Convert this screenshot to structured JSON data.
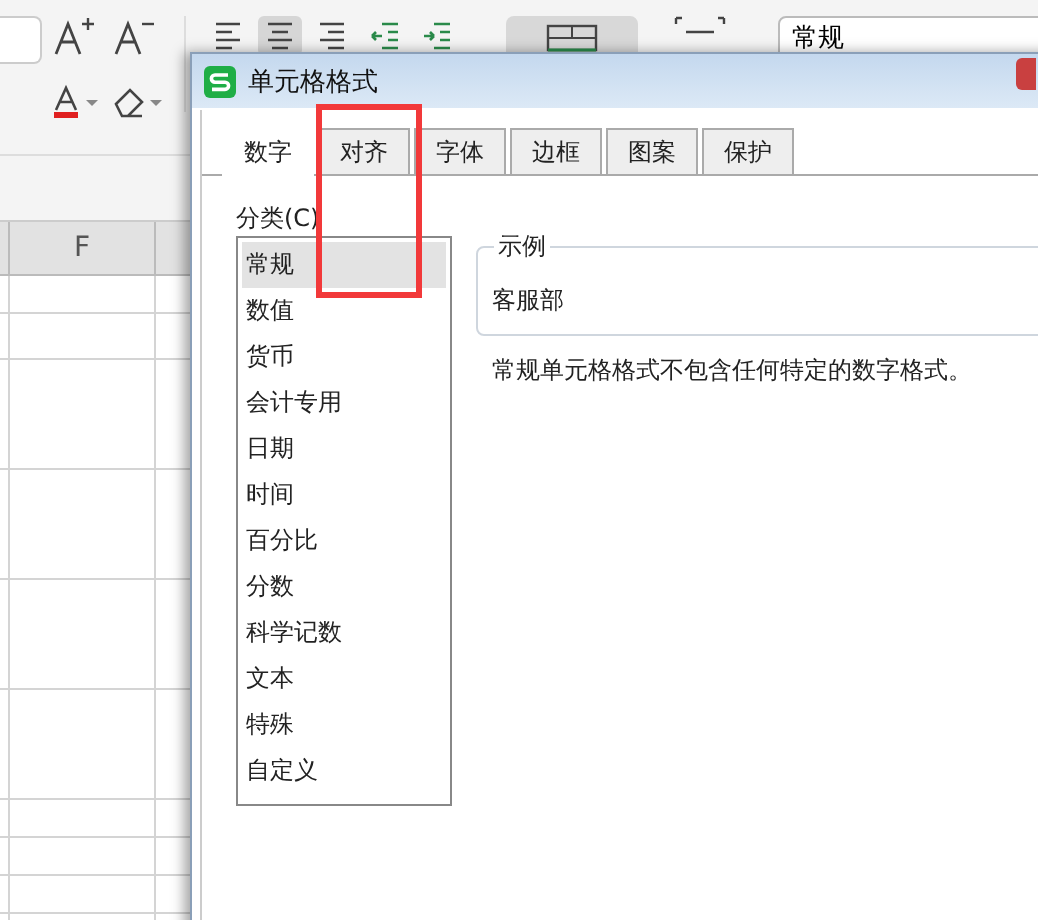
{
  "toolbar": {
    "alignment": [
      {
        "kind": "left",
        "selected": false
      },
      {
        "kind": "center",
        "selected": true
      },
      {
        "kind": "right",
        "selected": false
      },
      {
        "kind": "outdent",
        "selected": false
      },
      {
        "kind": "indent",
        "selected": false
      }
    ],
    "number_format": "常规"
  },
  "sheet": {
    "columns": [
      "F"
    ]
  },
  "dialog": {
    "title": "单元格格式",
    "tabs": [
      {
        "label": "数字",
        "selected": true
      },
      {
        "label": "对齐",
        "selected": false
      },
      {
        "label": "字体",
        "selected": false
      },
      {
        "label": "边框",
        "selected": false
      },
      {
        "label": "图案",
        "selected": false
      },
      {
        "label": "保护",
        "selected": false
      }
    ],
    "category_label": "分类(C)",
    "categories": [
      {
        "label": "常规",
        "selected": true
      },
      {
        "label": "数值",
        "selected": false
      },
      {
        "label": "货币",
        "selected": false
      },
      {
        "label": "会计专用",
        "selected": false
      },
      {
        "label": "日期",
        "selected": false
      },
      {
        "label": "时间",
        "selected": false
      },
      {
        "label": "百分比",
        "selected": false
      },
      {
        "label": "分数",
        "selected": false
      },
      {
        "label": "科学记数",
        "selected": false
      },
      {
        "label": "文本",
        "selected": false
      },
      {
        "label": "特殊",
        "selected": false
      },
      {
        "label": "自定义",
        "selected": false
      }
    ],
    "sample": {
      "legend": "示例",
      "value": "客服部"
    },
    "description": "常规单元格格式不包含任何特定的数字格式。"
  }
}
